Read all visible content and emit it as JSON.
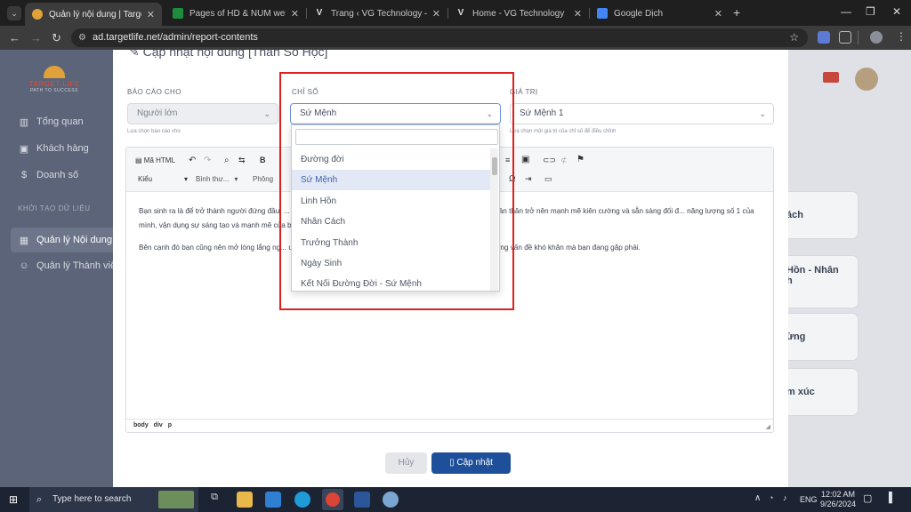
{
  "browser": {
    "tabs": [
      {
        "title": "Quản lý nội dung | Target Life",
        "color": "#e0a13a"
      },
      {
        "title": "Pages of HD & NUM web - Goo",
        "color": "#1e8e3e"
      },
      {
        "title": "Trang ‹ VG Technology — Word",
        "color": "#dddddd"
      },
      {
        "title": "Home - VG Technology",
        "color": "#dddddd"
      },
      {
        "title": "Google Dịch",
        "color": "#4285f4"
      }
    ],
    "new_tab": "+",
    "url": "ad.targetlife.net/admin/report-contents"
  },
  "logo": {
    "name": "TARGET LIFE",
    "slogan": "PATH TO SUCCESS"
  },
  "sidebar": {
    "items": [
      {
        "label": "Tổng quan",
        "icon": "chart-icon"
      },
      {
        "label": "Khách hàng",
        "icon": "user-card-icon"
      },
      {
        "label": "Doanh số",
        "icon": "dollar-icon"
      }
    ],
    "section": "KHỞI TẠO DỮ LIỆU",
    "data_items": [
      {
        "label": "Quản lý Nội dung",
        "icon": "grid-icon"
      },
      {
        "label": "Quản lý Thành viên",
        "icon": "users-icon"
      }
    ]
  },
  "bg_cards": [
    "ách",
    "Hồn - Nhân\nh",
    "ừng",
    "m xúc"
  ],
  "modal": {
    "title": "Cập nhật nội dung [Thẩn Số Học]",
    "report_for": {
      "label": "BÁO CÁO CHO",
      "value": "Người lớn",
      "hint": "Lựa chọn báo cáo cho"
    },
    "index": {
      "label": "CHỈ SỐ",
      "value": "Sứ Mệnh"
    },
    "value": {
      "label": "GIÁ TRỊ",
      "value": "Sứ Mệnh 1",
      "hint": "Lựa chọn một giá trị của chỉ số để điều chỉnh"
    },
    "toolbar": {
      "html": "Mã HTML",
      "style": "Kiểu",
      "format": "Bình thư...",
      "font": "Phông"
    },
    "body": [
      "Bạn sinh ra là để trở thành người đứng đầu, ... hở cho mọi người. Mục đích sống bạn hướng đến là rèn luyện bản thân trở nên mạnh mẽ kiên cường và sẵn sàng đối đ... năng lượng số 1 của mình, vận dụng sự sáng tạo và mạnh mẽ của bản thân, tập trung vào năng lực lãnh đạo và luôn tiến...",
      "Bên cạnh đó bạn cũng nên mở lòng lắng ng... uyện và phát triển bản thân mỗi ngày để có thể giải tỏa được những vấn đề khó khăn mà bạn đang gặp phải."
    ],
    "statusbar": "body div p",
    "cancel": "Hủy",
    "save": "Cập nhật"
  },
  "dropdown": {
    "options": [
      "Đường đời",
      "Sứ Mệnh",
      "Linh Hồn",
      "Nhân Cách",
      "Trưởng Thành",
      "Ngày Sinh",
      "Kết Nối Đường Đời - Sứ Mệnh"
    ],
    "selected_index": 1
  },
  "taskbar": {
    "search_placeholder": "Type here to search",
    "lang": "ENG",
    "time": "12:02 AM",
    "date": "9/26/2024"
  }
}
